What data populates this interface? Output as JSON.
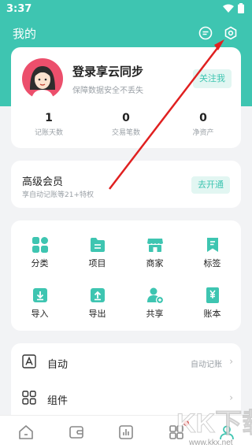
{
  "status_bar": {
    "time": "3:37"
  },
  "header": {
    "title": "我的"
  },
  "profile": {
    "title": "登录享云同步",
    "subtitle": "保障数据安全不丢失",
    "follow_label": "关注我",
    "stats": [
      {
        "value": "1",
        "label": "记账天数"
      },
      {
        "value": "0",
        "label": "交易笔数"
      },
      {
        "value": "0",
        "label": "净资产"
      }
    ]
  },
  "vip": {
    "title": "高级会员",
    "subtitle": "享自动记账等21+特权",
    "button_label": "去开通"
  },
  "features": [
    {
      "label": "分类",
      "icon": "category-icon"
    },
    {
      "label": "项目",
      "icon": "project-icon"
    },
    {
      "label": "商家",
      "icon": "merchant-icon"
    },
    {
      "label": "标签",
      "icon": "tag-icon"
    },
    {
      "label": "导入",
      "icon": "import-icon"
    },
    {
      "label": "导出",
      "icon": "export-icon"
    },
    {
      "label": "共享",
      "icon": "share-icon"
    },
    {
      "label": "账本",
      "icon": "ledger-icon"
    }
  ],
  "settings_list": [
    {
      "label": "自动",
      "value": "自动记账",
      "icon": "auto-icon"
    },
    {
      "label": "组件",
      "value": "",
      "icon": "widget-icon"
    }
  ],
  "bottom_nav": [
    "home-icon",
    "wallet-icon",
    "chart-icon",
    "apps-icon",
    "profile-icon"
  ],
  "watermark": {
    "text": "KK下载",
    "url": "www.kkx.net"
  },
  "colors": {
    "accent": "#3ec5b1",
    "accent_light": "#e2f6f2",
    "annotation": "#e02020"
  }
}
